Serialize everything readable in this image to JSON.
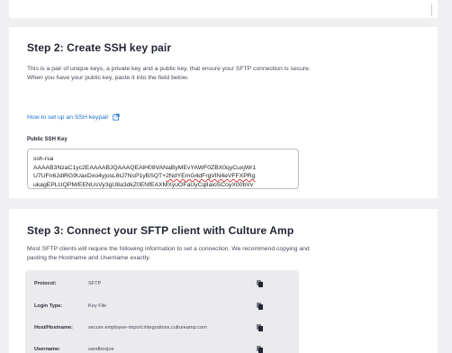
{
  "step2": {
    "title": "Step 2: Create SSH key pair",
    "description": "This is a pair of unique keys, a private key and a public key, that ensure your SFTP connection is secure. When you have your public key, paste it into the field below.",
    "link_label": "How to set up an SSH keypair",
    "field_label": "Public SSH Key",
    "key_line1": "ssh-rsa",
    "key_line2": "AAAAB3NzaC1yc2EAAAABJQAAAQEAlH08VANaByMEvYAWF0ZBX0qyCuxjWr1",
    "key_line3a": "U7UFn6JdlRG9UaxDxo4yjosL6tJ7NsP1yBSQT+",
    "key_line3b": "2NdYEmG4dFrgVlN4eVFFXPRg",
    "key_line4": "ukagEPLUQPM/EENUsVy3gU8a3dkZ0ENfEAXMXyuOFaUyCqlIaioSCoyX00bVv"
  },
  "step3": {
    "title": "Step 3: Connect your SFTP client with Culture Amp",
    "description": "Most SFTP clients will require the following information to set a connection. We recommend copying and pasting the Hostname and Username exactly.",
    "rows": [
      {
        "label": "Protocol:",
        "value": "SFTP"
      },
      {
        "label": "Login Type:",
        "value": "Key File"
      },
      {
        "label": "Host/Hostname:",
        "value": "secure.employee-import.integrations.cultureamp.com"
      },
      {
        "label": "Username:",
        "value": "sandboxjoe"
      }
    ]
  },
  "colors": {
    "link": "#1b6fc9",
    "background": "#f0f0f2",
    "card": "#ffffff",
    "table_bg": "#ebebed"
  },
  "icons": {
    "external_link": "external-link-icon",
    "copy": "copy-icon"
  }
}
